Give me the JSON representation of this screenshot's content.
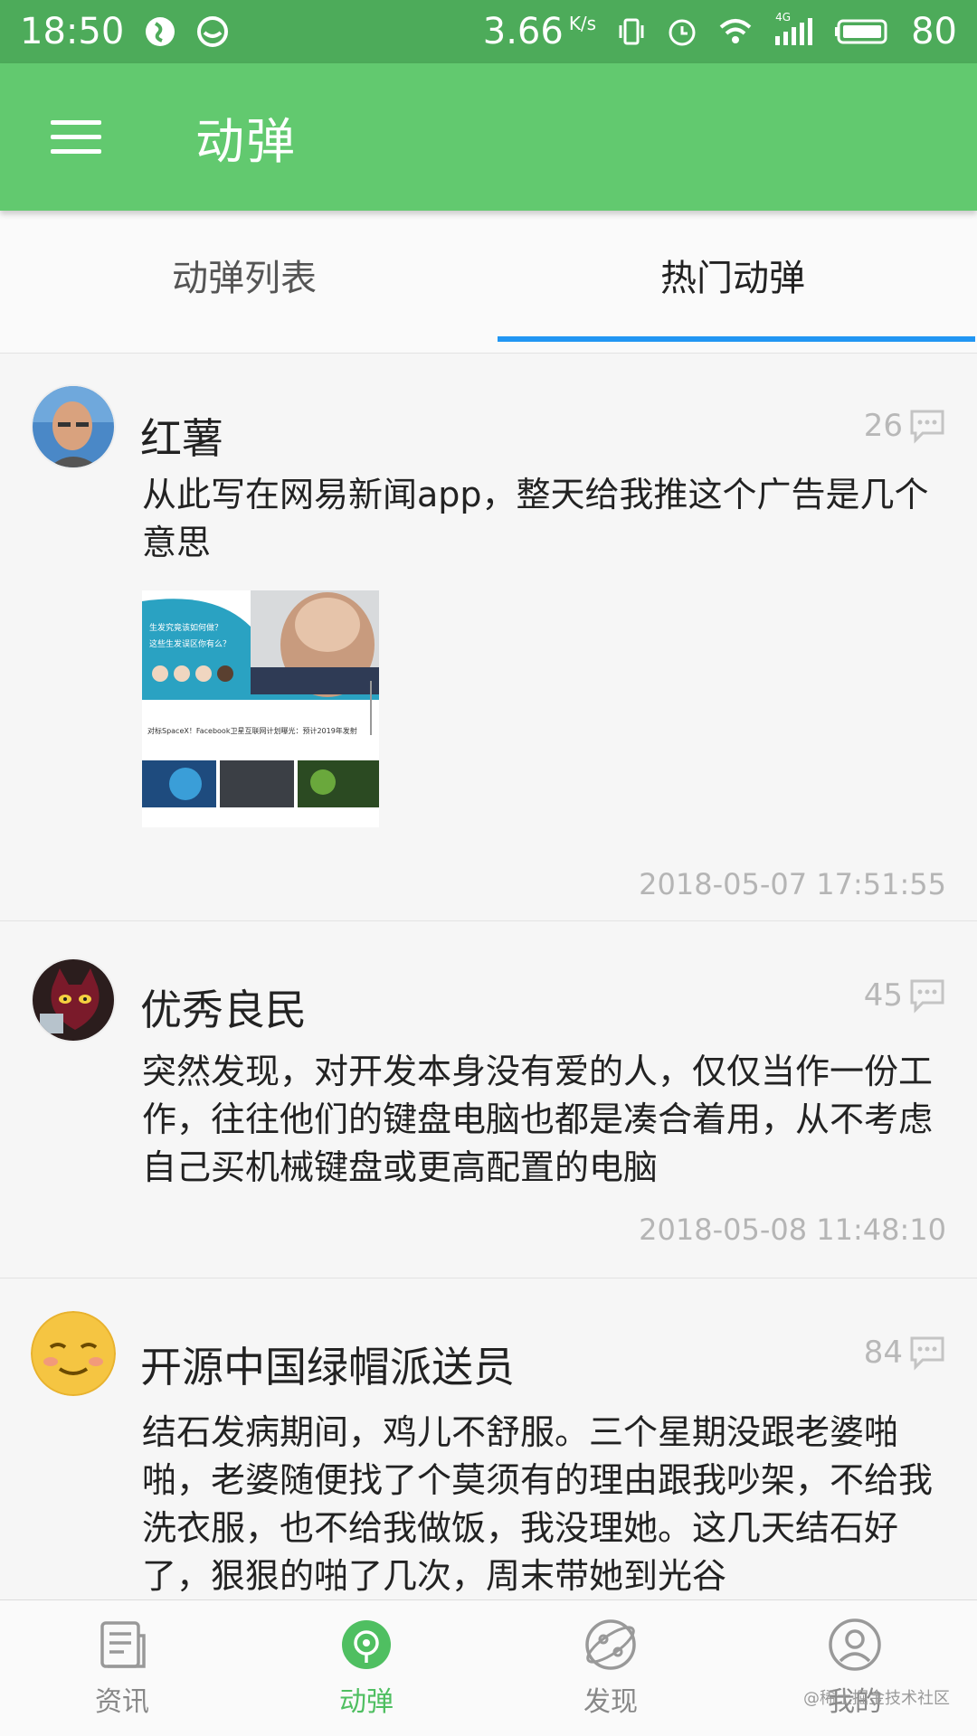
{
  "status_bar": {
    "time": "18:50",
    "net_speed": "3.66",
    "net_unit": "K/s",
    "network": "4G",
    "battery": "80"
  },
  "app_bar": {
    "title": "动弹"
  },
  "tabs": [
    {
      "label": "动弹列表",
      "active": false
    },
    {
      "label": "热门动弹",
      "active": true
    }
  ],
  "posts": [
    {
      "author": "红薯",
      "comments": "26",
      "content": "从此写在网易新闻app，整天给我推这个广告是几个意思",
      "time": "2018-05-07 17:51:55",
      "image": {
        "banner_line1": "生发究竟该如何做？",
        "banner_line2": "这些生发误区你有么？",
        "caption": "对标SpaceX！Facebook卫星互联网计划曝光：预计2019年发射"
      }
    },
    {
      "author": "优秀良民",
      "comments": "45",
      "content": "突然发现，对开发本身没有爱的人，仅仅当作一份工作，往往他们的键盘电脑也都是凑合着用，从不考虑自己买机械键盘或更高配置的电脑",
      "time": "2018-05-08 11:48:10"
    },
    {
      "author": "开源中国绿帽派送员",
      "comments": "84",
      "content": "结石发病期间，鸡儿不舒服。三个星期没跟老婆啪啪，老婆随便找了个莫须有的理由跟我吵架，不给我洗衣服，也不给我做饭，我没理她。这几天结石好了，狠狠的啪了几次，周末带她到光谷"
    }
  ],
  "bottom_nav": [
    {
      "label": "资讯",
      "icon": "news-icon",
      "active": false
    },
    {
      "label": "动弹",
      "icon": "tweet-icon",
      "active": true
    },
    {
      "label": "发现",
      "icon": "planet-icon",
      "active": false
    },
    {
      "label": "我的",
      "icon": "profile-icon",
      "active": false
    }
  ],
  "watermark": "@稀土掘金技术社区",
  "colors": {
    "status_bar": "#4dab5a",
    "app_bar": "#62c96f",
    "tab_indicator": "#2196f3",
    "nav_active": "#4fbf61"
  }
}
